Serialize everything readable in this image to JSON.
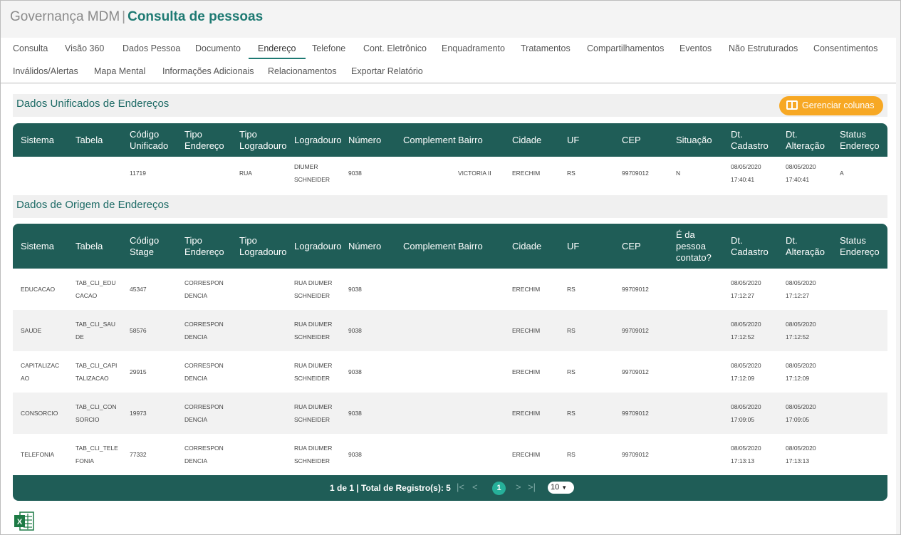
{
  "header": {
    "app_name": "Governança MDM",
    "separator": "|",
    "page_title": "Consulta de pessoas"
  },
  "tabs": [
    "Consulta",
    "Visão 360",
    "Dados Pessoa",
    "Documento",
    "Endereço",
    "Telefone",
    "Cont. Eletrônico",
    "Enquadramento",
    "Tratamentos",
    "Compartilhamentos",
    "Eventos",
    "Não Estruturados",
    "Consentimentos",
    "Inválidos/Alertas",
    "Mapa Mental",
    "Informações Adicionais",
    "Relacionamentos",
    "Exportar Relatório"
  ],
  "active_tab": "Endereço",
  "unified": {
    "title": "Dados Unificados de Endereços",
    "manage_columns_label": "Gerenciar colunas",
    "columns": [
      "Sistema",
      "Tabela",
      "Código\nUnificado",
      "Tipo\nEndereço",
      "Tipo\nLogradouro",
      "Logradouro",
      "Número",
      "Complemento",
      "Bairro",
      "Cidade",
      "UF",
      "CEP",
      "Situação",
      "Dt.\nCadastro",
      "Dt.\nAlteração",
      "Status\nEndereço"
    ],
    "rows": [
      [
        "",
        "",
        "11719",
        "",
        "RUA",
        "DIUMER\nSCHNEIDER",
        "9038",
        "",
        "VICTORIA II",
        "ERECHIM",
        "RS",
        "99709012",
        "N",
        "08/05/2020\n17:40:41",
        "08/05/2020\n17:40:41",
        "A"
      ]
    ]
  },
  "origin": {
    "title": "Dados de Origem de Endereços",
    "columns": [
      "Sistema",
      "Tabela",
      "Código\nStage",
      "Tipo\nEndereço",
      "Tipo\nLogradouro",
      "Logradouro",
      "Número",
      "Complemento",
      "Bairro",
      "Cidade",
      "UF",
      "CEP",
      "É da\npessoa\ncontato?",
      "Dt.\nCadastro",
      "Dt.\nAlteração",
      "Status\nEndereço"
    ],
    "rows": [
      [
        "EDUCACAO",
        "TAB_CLI_EDU\nCACAO",
        "45347",
        "CORRESPON\nDENCIA",
        "",
        "RUA DIUMER\nSCHNEIDER",
        "9038",
        "",
        "",
        "ERECHIM",
        "RS",
        "99709012",
        "",
        "08/05/2020\n17:12:27",
        "08/05/2020\n17:12:27",
        ""
      ],
      [
        "SAUDE",
        "TAB_CLI_SAU\nDE",
        "58576",
        "CORRESPON\nDENCIA",
        "",
        "RUA DIUMER\nSCHNEIDER",
        "9038",
        "",
        "",
        "ERECHIM",
        "RS",
        "99709012",
        "",
        "08/05/2020\n17:12:52",
        "08/05/2020\n17:12:52",
        ""
      ],
      [
        "CAPITALIZAC\nAO",
        "TAB_CLI_CAPI\nTALIZACAO",
        "29915",
        "CORRESPON\nDENCIA",
        "",
        "RUA DIUMER\nSCHNEIDER",
        "9038",
        "",
        "",
        "ERECHIM",
        "RS",
        "99709012",
        "",
        "08/05/2020\n17:12:09",
        "08/05/2020\n17:12:09",
        ""
      ],
      [
        "CONSORCIO",
        "TAB_CLI_CON\nSORCIO",
        "19973",
        "CORRESPON\nDENCIA",
        "",
        "RUA DIUMER\nSCHNEIDER",
        "9038",
        "",
        "",
        "ERECHIM",
        "RS",
        "99709012",
        "",
        "08/05/2020\n17:09:05",
        "08/05/2020\n17:09:05",
        ""
      ],
      [
        "TELEFONIA",
        "TAB_CLI_TELE\nFONIA",
        "77332",
        "CORRESPON\nDENCIA",
        "",
        "RUA DIUMER\nSCHNEIDER",
        "9038",
        "",
        "",
        "ERECHIM",
        "RS",
        "99709012",
        "",
        "08/05/2020\n17:13:13",
        "08/05/2020\n17:13:13",
        ""
      ]
    ]
  },
  "pagination": {
    "info": "1 de 1 | Total de Registro(s): 5",
    "first_icon": "|<",
    "prev_icon": "<",
    "current_page": "1",
    "next_icon": ">",
    "last_icon": ">|",
    "page_size": "10"
  },
  "export": {
    "icon": "excel-icon",
    "letter": "X"
  },
  "colors": {
    "primary": "#1f5d57",
    "accent": "#1e7a73",
    "button": "#f7a824",
    "current_page": "#26b09a"
  }
}
